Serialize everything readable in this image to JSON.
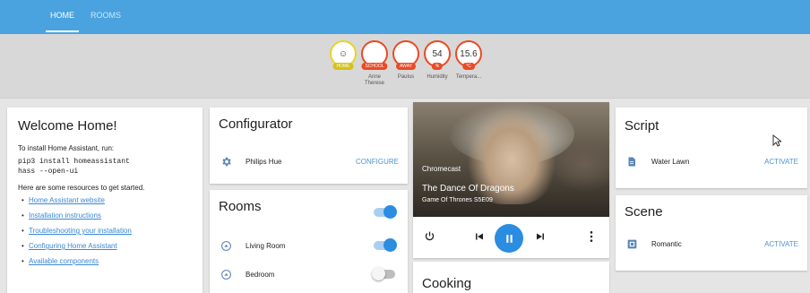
{
  "tabs": [
    {
      "label": "HOME",
      "active": true
    },
    {
      "label": "ROOMS",
      "active": false
    }
  ],
  "badges": [
    {
      "value": "☺",
      "pill": "HOME",
      "label": "",
      "color": "#e7d42a"
    },
    {
      "value": "",
      "pill": "SCHOOL",
      "label": "Anne\nTherese",
      "color": "#e94b25"
    },
    {
      "value": "",
      "pill": "AWAY",
      "label": "Paulus",
      "color": "#e94b25"
    },
    {
      "value": "54",
      "pill": "%",
      "label": "Humidity",
      "color": "#e94b25"
    },
    {
      "value": "15.6",
      "pill": "°C",
      "label": "Tempera...",
      "color": "#e94b25"
    }
  ],
  "welcome": {
    "title": "Welcome Home!",
    "install_text": "To install Home Assistant, run:",
    "code_line1": "pip3 install homeassistant",
    "code_line2": "hass --open-ui",
    "resources_text": "Here are some resources to get started.",
    "links": [
      "Home Assistant website",
      "Installation instructions",
      "Troubleshooting your installation",
      "Configuring Home Assistant",
      "Available components"
    ]
  },
  "configurator": {
    "title": "Configurator",
    "item": "Philips Hue",
    "action": "CONFIGURE",
    "icon": "gear-icon"
  },
  "rooms": {
    "title": "Rooms",
    "group_toggle_on": true,
    "items": [
      {
        "name": "Living Room",
        "on": true,
        "icon": "room-icon"
      },
      {
        "name": "Bedroom",
        "on": false,
        "icon": "room-icon"
      }
    ]
  },
  "media": {
    "app": "Chromecast",
    "title": "The Dance Of Dragons",
    "subtitle": "Game Of Thrones S5E09",
    "state": "playing"
  },
  "cooking": {
    "title": "Cooking"
  },
  "script": {
    "title": "Script",
    "item": "Water Lawn",
    "action": "ACTIVATE",
    "icon": "file-icon"
  },
  "scene": {
    "title": "Scene",
    "item": "Romantic",
    "action": "ACTIVATE",
    "icon": "scene-icon"
  },
  "colors": {
    "header": "#4aa3df",
    "accent": "#2b8de1",
    "badge_red": "#e94b25",
    "badge_yellow": "#e7d42a"
  }
}
